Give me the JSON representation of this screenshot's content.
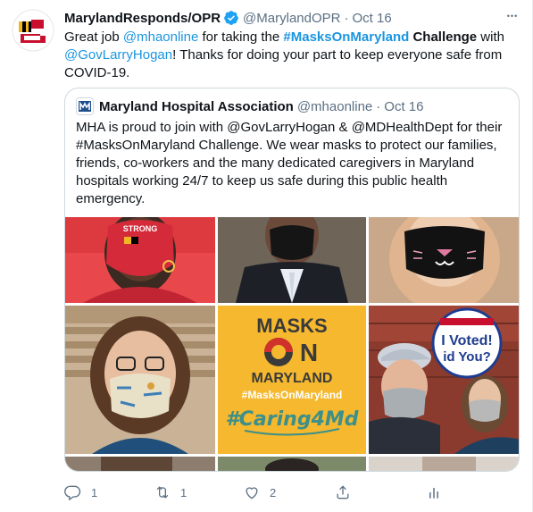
{
  "tweet": {
    "display_name": "MarylandResponds/OPR",
    "handle": "@MarylandOPR",
    "separator": "·",
    "date": "Oct 16",
    "more_label": "•••",
    "text": {
      "t1": "Great job ",
      "m1": "@mhaonline",
      "t2": " for taking the ",
      "h1": "#MasksOnMaryland",
      "t3": " Challenge",
      "t4": " with ",
      "m2": "@GovLarryHogan",
      "t5": "! Thanks for doing your part to keep everyone safe from COVID-19."
    }
  },
  "quote": {
    "display_name": "Maryland Hospital Association",
    "handle": "@mhaonline",
    "separator": "·",
    "date": "Oct 16",
    "text": "MHA is proud to join with @GovLarryHogan & @MDHealthDept for their #MasksOnMaryland Challenge. We wear masks to protect our families, friends, co-workers and the many dedicated caregivers in Maryland hospitals working 24/7 to keep us safe during this public health emergency."
  },
  "media": {
    "mask_print": "STRONG",
    "graphic_line1": "MASKS",
    "graphic_line2a": "O",
    "graphic_line2b": "N",
    "graphic_line3": "MARYLAND",
    "graphic_hashtag": "#MasksOnMaryland",
    "graphic_script": "#Caring4Md",
    "sign_line1": "I Voted!",
    "sign_line2": "id You?"
  },
  "actions": {
    "reply_count": "1",
    "retweet_count": "1",
    "like_count": "2"
  },
  "colors": {
    "link": "#1b95e0",
    "muted": "#5b7083",
    "verified": "#1da1f2",
    "graphic_yellow": "#f5b82e"
  },
  "icons": [
    "verified-badge-icon",
    "more-icon",
    "reply-icon",
    "retweet-icon",
    "like-icon",
    "share-icon",
    "analytics-icon"
  ]
}
